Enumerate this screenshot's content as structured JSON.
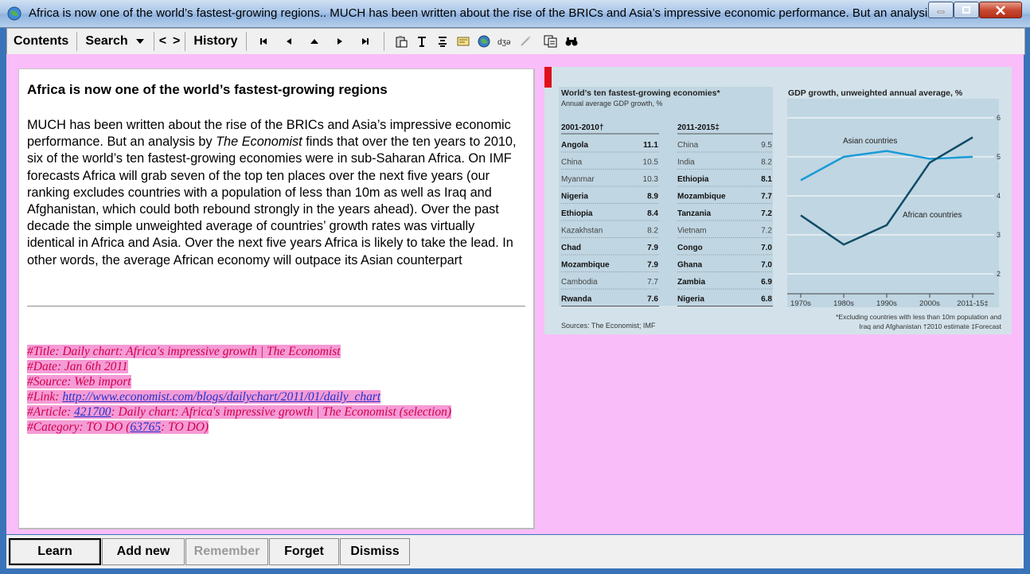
{
  "window": {
    "title": "Africa is now one of the world’s fastest-growing regions.. MUCH has been written about the rise of the BRICs and Asia’s impressive economic performance. But an analysi..."
  },
  "toolbar": {
    "contents": "Contents",
    "search": "Search",
    "prev": "<",
    "next": ">",
    "history": "History"
  },
  "article": {
    "title": "Africa is now one of the world’s fastest-growing regions",
    "body_part1": "MUCH has been written about the rise of the BRICs and Asia’s impressive economic performance. But an analysis by ",
    "body_italic": "The Economist",
    "body_part2": " finds that over the ten years to 2010, six of the world’s ten fastest-growing economies were in sub-Saharan Africa. On IMF forecasts Africa will grab seven of the top ten places over the next five years (our ranking excludes countries with a population of less than 10m as well as Iraq and Afghanistan, which could both rebound strongly in the years ahead). Over the past decade the simple unweighted average of countries’ growth rates was virtually identical in Africa and Asia. Over the next five years Africa is likely to take the lead. In other words, the average African economy will outpace its Asian counterpart"
  },
  "meta": {
    "title_line": "#Title: Daily chart: Africa's impressive growth | The Economist",
    "date_line": "#Date: Jan 6th 2011",
    "source_line": "#Source: Web import",
    "link_label": "#Link: ",
    "link_url": "http://www.economist.com/blogs/dailychart/2011/01/daily_chart",
    "article_label": "#Article: ",
    "article_id": "421700",
    "article_rest": ": Daily chart: Africa's impressive growth | The Economist (selection)",
    "category_label": "#Category: TO DO (",
    "category_id": "63765",
    "category_rest": ": TO DO)"
  },
  "chart_data": [
    {
      "type": "table",
      "title": "World’s ten fastest-growing economies*",
      "subtitle": "Annual average GDP growth, %",
      "columns": [
        {
          "header": "2001-2010†",
          "rows": [
            {
              "country": "Angola",
              "value": "11.1",
              "african": true
            },
            {
              "country": "China",
              "value": "10.5",
              "african": false
            },
            {
              "country": "Myanmar",
              "value": "10.3",
              "african": false
            },
            {
              "country": "Nigeria",
              "value": "8.9",
              "african": true
            },
            {
              "country": "Ethiopia",
              "value": "8.4",
              "african": true
            },
            {
              "country": "Kazakhstan",
              "value": "8.2",
              "african": false
            },
            {
              "country": "Chad",
              "value": "7.9",
              "african": true
            },
            {
              "country": "Mozambique",
              "value": "7.9",
              "african": true
            },
            {
              "country": "Cambodia",
              "value": "7.7",
              "african": false
            },
            {
              "country": "Rwanda",
              "value": "7.6",
              "african": true
            }
          ]
        },
        {
          "header": "2011-2015‡",
          "rows": [
            {
              "country": "China",
              "value": "9.5",
              "african": false
            },
            {
              "country": "India",
              "value": "8.2",
              "african": false
            },
            {
              "country": "Ethiopia",
              "value": "8.1",
              "african": true
            },
            {
              "country": "Mozambique",
              "value": "7.7",
              "african": true
            },
            {
              "country": "Tanzania",
              "value": "7.2",
              "african": true
            },
            {
              "country": "Vietnam",
              "value": "7.2",
              "african": false
            },
            {
              "country": "Congo",
              "value": "7.0",
              "african": true
            },
            {
              "country": "Ghana",
              "value": "7.0",
              "african": true
            },
            {
              "country": "Zambia",
              "value": "6.9",
              "african": true
            },
            {
              "country": "Nigeria",
              "value": "6.8",
              "african": true
            }
          ]
        }
      ],
      "source": "Sources: The Economist; IMF"
    },
    {
      "type": "line",
      "title": "GDP growth, unweighted annual average, %",
      "categories": [
        "1970s",
        "1980s",
        "1990s",
        "2000s",
        "2011-15‡"
      ],
      "ylim": [
        2,
        6
      ],
      "yticks": [
        2,
        3,
        4,
        5,
        6
      ],
      "series": [
        {
          "name": "Asian countries",
          "values": [
            4.4,
            5.0,
            5.15,
            4.95,
            5.0
          ],
          "color": "#1b9ad6"
        },
        {
          "name": "African countries",
          "values": [
            3.5,
            2.75,
            3.25,
            4.85,
            5.5
          ],
          "color": "#0f4c66"
        }
      ],
      "footnote_1": "*Excluding countries with less than 10m population and",
      "footnote_2": "Iraq and Afghanistan   †2010 estimate   ‡Forecast"
    }
  ],
  "buttons": {
    "learn": "Learn",
    "add_new": "Add new",
    "remember": "Remember",
    "forget": "Forget",
    "dismiss": "Dismiss"
  }
}
